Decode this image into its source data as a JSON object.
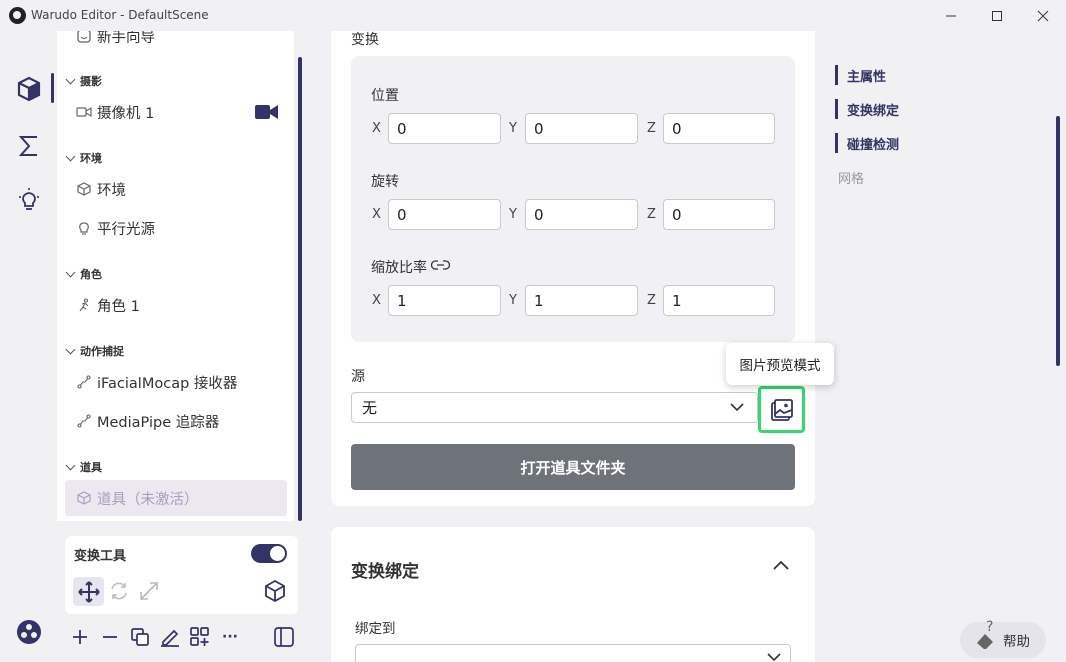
{
  "window": {
    "title": "Warudo Editor - DefaultScene",
    "controls": [
      "minimize",
      "maximize",
      "close"
    ]
  },
  "leftbar": {
    "icons": [
      "cube-icon",
      "sigma-icon",
      "lightbulb-icon"
    ],
    "bottom_icon": "community-icon"
  },
  "sidebar": {
    "partial_item": "新手向导",
    "sections": [
      {
        "title": "摄影",
        "items": [
          {
            "label": "摄像机 1",
            "icon": "camera-icon"
          }
        ]
      },
      {
        "title": "环境",
        "items": [
          {
            "label": "环境",
            "icon": "environment-icon"
          },
          {
            "label": "平行光源",
            "icon": "bulb-icon"
          }
        ]
      },
      {
        "title": "角色",
        "items": [
          {
            "label": "角色 1",
            "icon": "character-icon"
          }
        ]
      },
      {
        "title": "动作捕捉",
        "items": [
          {
            "label": "iFacialMocap 接收器",
            "icon": "mocap-icon"
          },
          {
            "label": "MediaPipe 追踪器",
            "icon": "mocap-icon"
          }
        ]
      },
      {
        "title": "道具",
        "items": [
          {
            "label": "道具（未激活）",
            "icon": "prop-icon"
          }
        ]
      }
    ]
  },
  "tools": {
    "label": "变换工具",
    "toggle_on": true
  },
  "main": {
    "section_title": "变换",
    "position": {
      "label": "位置",
      "x": "0",
      "y": "0",
      "z": "0"
    },
    "rotation": {
      "label": "旋转",
      "x": "0",
      "y": "0",
      "z": "0"
    },
    "scale": {
      "label": "缩放比率",
      "x": "1",
      "y": "1",
      "z": "1"
    },
    "axes": {
      "x": "X",
      "y": "Y",
      "z": "Z"
    },
    "source": {
      "label": "源",
      "value": "无"
    },
    "tooltip": "图片预览模式",
    "open_folder_button": "打开道具文件夹"
  },
  "card2": {
    "title": "变换绑定",
    "bind_label": "绑定到"
  },
  "rightnav": {
    "items": [
      "主属性",
      "变换绑定",
      "碰撞检测",
      "网格"
    ]
  },
  "help": {
    "label": "帮助"
  },
  "colors": {
    "accent": "#333366",
    "highlight": "#34d86c",
    "button_dark": "#6e737a"
  }
}
